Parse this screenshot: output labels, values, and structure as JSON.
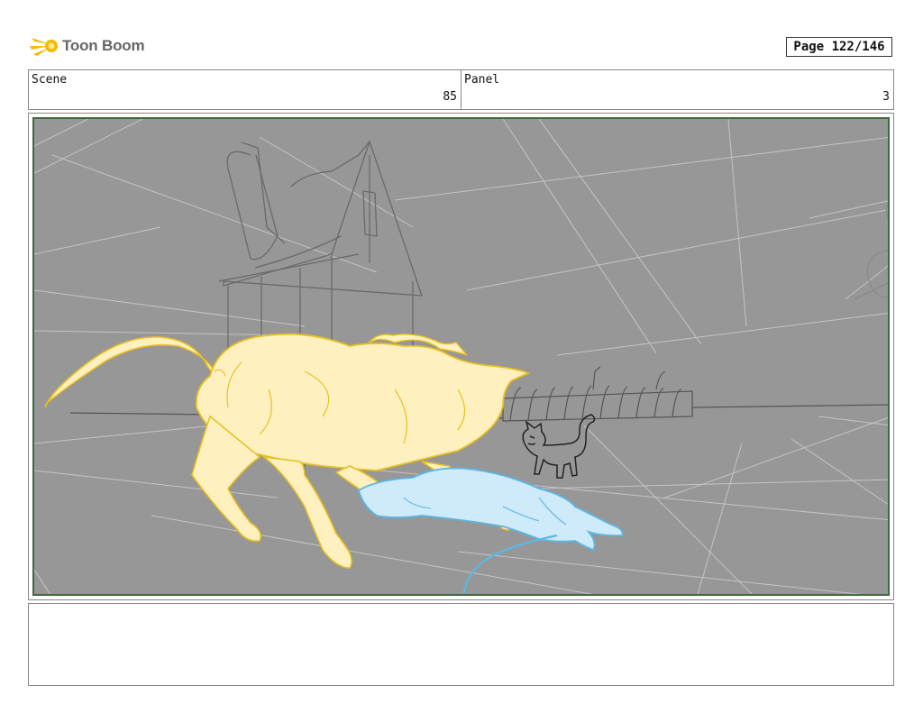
{
  "header": {
    "logo_text": "Toon Boom",
    "page_label": "Page 122/146"
  },
  "panel_info": {
    "scene_label": "Scene",
    "scene_value": "85",
    "panel_label": "Panel",
    "panel_value": "3"
  },
  "artwork": {
    "subjects": [
      "yellow-lion-figure",
      "blue-lioness-figure",
      "small-cat-figure",
      "house-sketch",
      "fence-sketch"
    ],
    "colors": {
      "background": "#979797",
      "frame_border": "#3d6b3d",
      "lion_fill": "#fff0c0",
      "lion_stroke": "#e8c020",
      "lioness_fill": "#cfeaf8",
      "lioness_stroke": "#5ab8e6"
    }
  },
  "notes": {
    "text": ""
  }
}
